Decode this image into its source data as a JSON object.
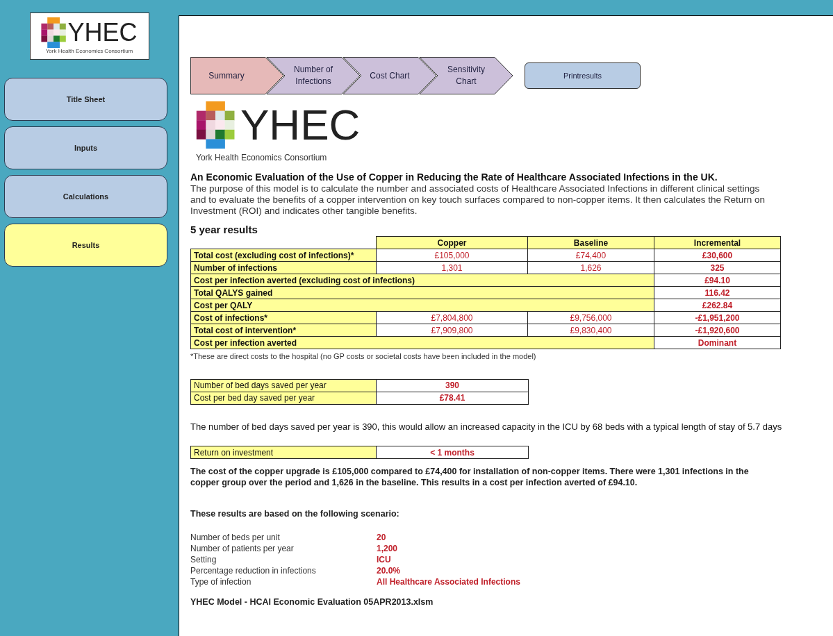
{
  "sidebar": {
    "logo": {
      "wordmark": "YHEC",
      "tagline": "York Health Economics Consortium"
    },
    "items": [
      {
        "label": "Title Sheet",
        "selected": false
      },
      {
        "label": "Inputs",
        "selected": false
      },
      {
        "label": "Calculations",
        "selected": false
      },
      {
        "label": "Results",
        "selected": true
      }
    ]
  },
  "steps": [
    {
      "label": "Summary",
      "selected": true
    },
    {
      "label": "Number of Infections",
      "selected": false
    },
    {
      "label": "Cost Chart",
      "selected": false
    },
    {
      "label": "Sensitivity Chart",
      "selected": false
    }
  ],
  "print_button": "Printresults",
  "logo": {
    "wordmark": "YHEC",
    "tagline": "York Health Economics Consortium"
  },
  "title": "An Economic Evaluation of the Use of Copper in Reducing the Rate of Healthcare Associated Infections in the UK.",
  "intro": "The purpose of this model is to calculate the number and associated costs of Healthcare Associated Infections in different clinical settings and to evaluate the benefits of a copper intervention on key touch surfaces compared to non-copper items.  It then calculates the Return on Investment (ROI) and indicates other tangible benefits.",
  "results": {
    "heading": "5 year results",
    "columns": [
      "Copper",
      "Baseline",
      "Incremental"
    ],
    "rows": [
      {
        "kind": "split",
        "label": "Total cost (excluding cost of infections)*",
        "copper": "£105,000",
        "baseline": "£74,400",
        "incremental": "£30,600"
      },
      {
        "kind": "split",
        "label": "Number of infections",
        "copper": "1,301",
        "baseline": "1,626",
        "incremental": "325"
      },
      {
        "kind": "merged",
        "label": "Cost per infection averted (excluding cost of infections)",
        "incremental": "£94.10"
      },
      {
        "kind": "merged",
        "label": "Total QALYS gained",
        "incremental": "116.42"
      },
      {
        "kind": "merged",
        "label": "Cost per QALY",
        "incremental": "£262.84"
      },
      {
        "kind": "split",
        "label": "Cost of infections*",
        "copper": "£7,804,800",
        "baseline": "£9,756,000",
        "incremental": "-£1,951,200"
      },
      {
        "kind": "split",
        "label": "Total cost of intervention*",
        "copper": "£7,909,800",
        "baseline": "£9,830,400",
        "incremental": "-£1,920,600"
      },
      {
        "kind": "merged",
        "label": "Cost per infection averted",
        "incremental": "Dominant"
      }
    ],
    "footnote": "*These are direct costs to the hospital (no GP costs or societal costs have been included in the model)"
  },
  "bed_days": [
    {
      "label": "Number of bed days saved per year",
      "value": "390"
    },
    {
      "label": "Cost per bed day saved per year",
      "value": "£78.41"
    }
  ],
  "bed_days_note": "The number of bed days saved per year is 390, this would allow an increased capacity in the ICU by 68 beds with a typical length of stay of 5.7 days",
  "roi": {
    "label": "Return on investment",
    "value": "< 1 months"
  },
  "summary": "The cost of the copper upgrade is £105,000 compared to £74,400 for installation of non-copper items.  There were 1,301 infections in the copper group over the period and 1,626 in the baseline.  This results in a cost per infection averted of £94.10.",
  "scenario": {
    "heading": "These results are based on the following scenario:",
    "rows": [
      {
        "label": "Number of beds per unit",
        "value": "20"
      },
      {
        "label": "Number of patients per year",
        "value": "1,200"
      },
      {
        "label": "Setting",
        "value": "ICU"
      },
      {
        "label": "Percentage reduction in infections",
        "value": "20.0%"
      },
      {
        "label": "Type of infection",
        "value": "All Healthcare Associated Infections"
      }
    ]
  },
  "filename": "YHEC Model - HCAI Economic Evaluation 05APR2013.xlsm"
}
